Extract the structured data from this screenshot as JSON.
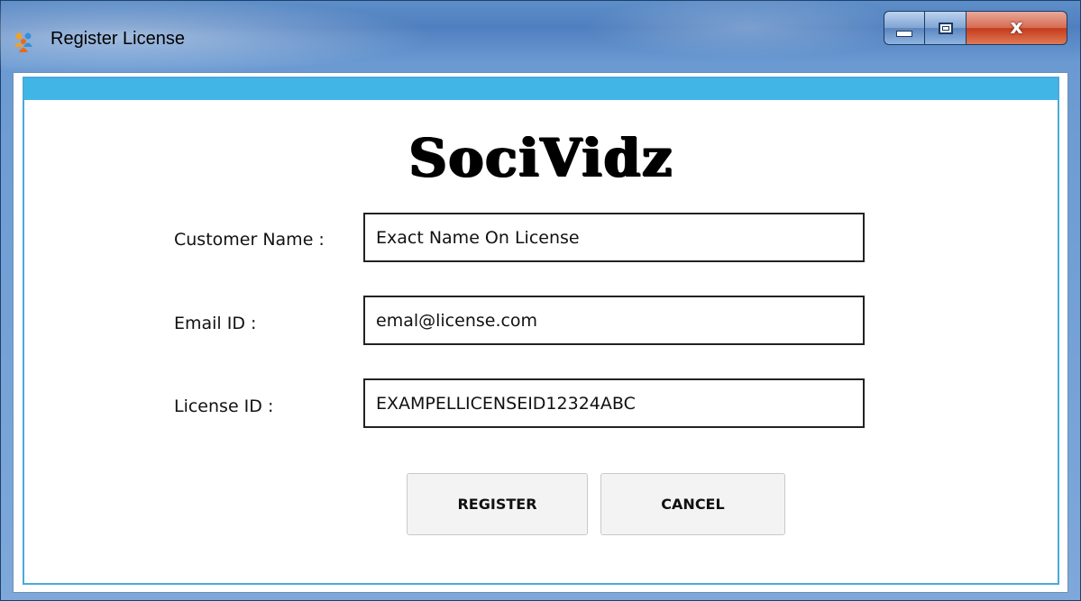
{
  "window": {
    "title": "Register License",
    "icon": "app-logo-icon",
    "controls": {
      "minimize": "minimize-icon",
      "maximize": "maximize-icon",
      "close_glyph": "x"
    }
  },
  "brand": {
    "text": "SociVidz"
  },
  "form": {
    "customer_name": {
      "label": "Customer Name :",
      "value": "Exact Name On License"
    },
    "email": {
      "label": "Email ID :",
      "value": "emal@license.com"
    },
    "license": {
      "label": "License ID :",
      "value": "EXAMPELLICENSEID12324ABC"
    }
  },
  "buttons": {
    "register": "REGISTER",
    "cancel": "CANCEL"
  },
  "colors": {
    "accent_bar": "#41b6e6",
    "panel_border": "#4aa9db",
    "titlebar": "#4f7fbf",
    "close_button": "#c43a1b"
  }
}
